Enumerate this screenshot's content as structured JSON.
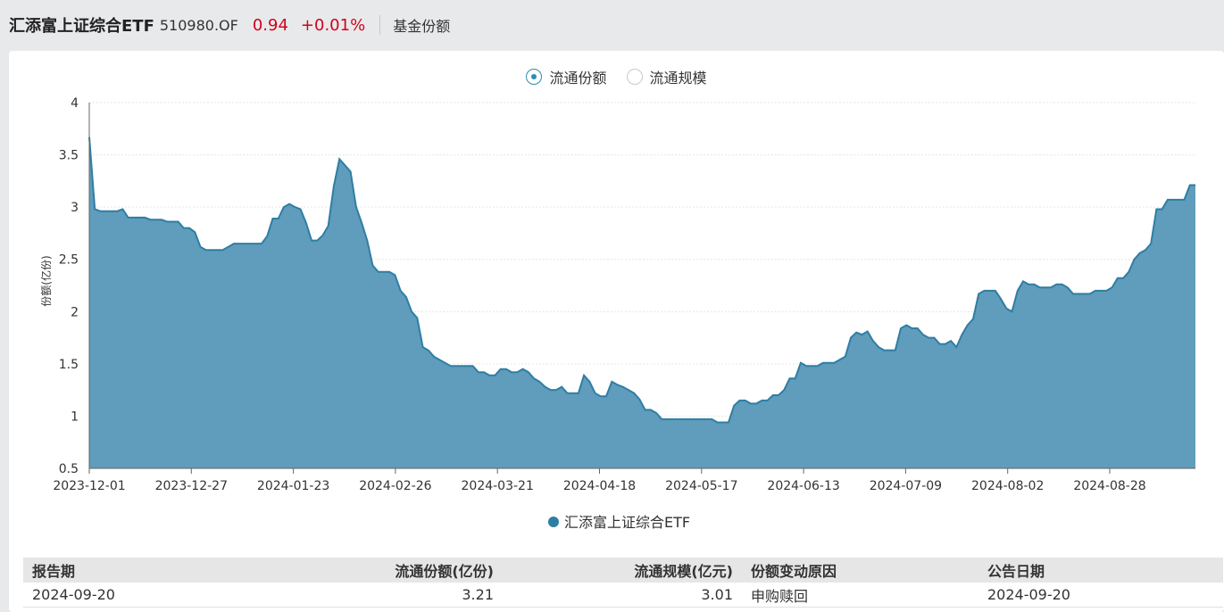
{
  "header": {
    "fund_name": "汇添富上证综合ETF",
    "fund_code": "510980.OF",
    "price": "0.94",
    "change": "+0.01%",
    "tab": "基金份额"
  },
  "toggle": {
    "options": [
      "流通份额",
      "流通规模"
    ],
    "selected": "流通份额"
  },
  "legend_label": "汇添富上证综合ETF",
  "colors": {
    "series": "#2e7ea4",
    "fill": "#4f91b4",
    "price": "#d0021b"
  },
  "chart_data": {
    "type": "area",
    "ylabel": "份额(亿份)",
    "ylim": [
      0.5,
      4
    ],
    "yticks": [
      0.5,
      1,
      1.5,
      2,
      2.5,
      3,
      3.5,
      4
    ],
    "xticks": [
      "2023-12-01",
      "2023-12-27",
      "2024-01-23",
      "2024-02-26",
      "2024-03-21",
      "2024-04-18",
      "2024-05-17",
      "2024-06-13",
      "2024-07-09",
      "2024-08-02",
      "2024-08-28"
    ],
    "series": [
      {
        "name": "汇添富上证综合ETF",
        "values": [
          3.67,
          2.98,
          2.96,
          2.96,
          2.96,
          2.96,
          2.98,
          2.9,
          2.9,
          2.9,
          2.9,
          2.88,
          2.88,
          2.88,
          2.86,
          2.86,
          2.86,
          2.8,
          2.8,
          2.76,
          2.62,
          2.59,
          2.59,
          2.59,
          2.59,
          2.62,
          2.65,
          2.65,
          2.65,
          2.65,
          2.65,
          2.65,
          2.72,
          2.89,
          2.89,
          3.0,
          3.03,
          3.0,
          2.98,
          2.85,
          2.68,
          2.68,
          2.73,
          2.82,
          3.2,
          3.46,
          3.4,
          3.34,
          3.0,
          2.85,
          2.68,
          2.44,
          2.38,
          2.38,
          2.38,
          2.35,
          2.2,
          2.14,
          2.0,
          1.94,
          1.66,
          1.63,
          1.57,
          1.54,
          1.51,
          1.48,
          1.48,
          1.48,
          1.48,
          1.48,
          1.42,
          1.42,
          1.39,
          1.39,
          1.45,
          1.45,
          1.42,
          1.42,
          1.45,
          1.42,
          1.36,
          1.33,
          1.28,
          1.25,
          1.25,
          1.28,
          1.22,
          1.22,
          1.22,
          1.39,
          1.33,
          1.22,
          1.19,
          1.19,
          1.33,
          1.3,
          1.28,
          1.25,
          1.22,
          1.16,
          1.06,
          1.06,
          1.03,
          0.97,
          0.97,
          0.97,
          0.97,
          0.97,
          0.97,
          0.97,
          0.97,
          0.97,
          0.97,
          0.94,
          0.94,
          0.94,
          1.1,
          1.15,
          1.15,
          1.12,
          1.12,
          1.15,
          1.15,
          1.2,
          1.2,
          1.25,
          1.36,
          1.36,
          1.51,
          1.48,
          1.48,
          1.48,
          1.51,
          1.51,
          1.51,
          1.54,
          1.57,
          1.75,
          1.8,
          1.78,
          1.81,
          1.72,
          1.66,
          1.63,
          1.63,
          1.63,
          1.84,
          1.87,
          1.84,
          1.84,
          1.78,
          1.75,
          1.75,
          1.69,
          1.69,
          1.72,
          1.66,
          1.78,
          1.87,
          1.93,
          2.17,
          2.2,
          2.2,
          2.2,
          2.12,
          2.03,
          2.0,
          2.2,
          2.29,
          2.26,
          2.26,
          2.23,
          2.23,
          2.23,
          2.26,
          2.26,
          2.23,
          2.17,
          2.17,
          2.17,
          2.17,
          2.2,
          2.2,
          2.2,
          2.23,
          2.32,
          2.32,
          2.38,
          2.5,
          2.56,
          2.59,
          2.65,
          2.98,
          2.98,
          3.07,
          3.07,
          3.07,
          3.07,
          3.21,
          3.21
        ]
      }
    ]
  },
  "table": {
    "headers": [
      "报告期",
      "流通份额(亿份)",
      "流通规模(亿元)",
      "份额变动原因",
      "公告日期"
    ],
    "rows": [
      [
        "2024-09-20",
        "3.21",
        "3.01",
        "申购赎回",
        "2024-09-20"
      ]
    ]
  }
}
